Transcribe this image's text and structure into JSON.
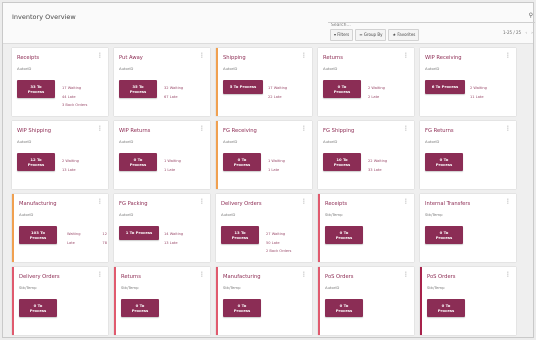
{
  "header": {
    "title": "Inventory Overview",
    "search_placeholder": "Search...",
    "filters": "▾ Filters",
    "group_by": "≡ Group By",
    "favorites": "★ Favorites",
    "pager": "1-25 / 25"
  },
  "cards": [
    {
      "title": "Receipts",
      "sub": "AutoriD",
      "btn": "33 To\nProcess",
      "stats": [
        "17 Waiting",
        "44 Late",
        "3 Back Orders"
      ],
      "bar": ""
    },
    {
      "title": "Put Away",
      "sub": "AutoriD",
      "btn": "35 To\nProcess",
      "stats": [
        "32 Waiting",
        "67 Late"
      ],
      "bar": ""
    },
    {
      "title": "Shipping",
      "sub": "AutoriD",
      "btn": "5 To Process",
      "stats": [
        "17 Waiting",
        "22 Late"
      ],
      "bar": "orange",
      "wide": true
    },
    {
      "title": "Returns",
      "sub": "AutoriD",
      "btn": "0 To\nProcess",
      "stats": [
        "2 Waiting",
        "2 Late"
      ],
      "bar": ""
    },
    {
      "title": "WIP Receiving",
      "sub": "AutoriD",
      "btn": "6 To Process",
      "stats": [
        "2 Waiting",
        "11 Late"
      ],
      "bar": "",
      "wide": true
    },
    {
      "title": "WIP Shipping",
      "sub": "AutoriD",
      "btn": "12 To\nProcess",
      "stats": [
        "2 Waiting",
        "13 Late"
      ],
      "bar": ""
    },
    {
      "title": "WIP Returns",
      "sub": "AutoriD",
      "btn": "0 To\nProcess",
      "stats": [
        "1 Waiting",
        "1 Late"
      ],
      "bar": ""
    },
    {
      "title": "FG Receiving",
      "sub": "AutoriD",
      "btn": "0 To\nProcess",
      "stats": [
        "1 Waiting",
        "1 Late"
      ],
      "bar": "orange"
    },
    {
      "title": "FG Shipping",
      "sub": "AutoriD",
      "btn": "10 To\nProcess",
      "stats": [
        "22 Waiting",
        "33 Late"
      ],
      "bar": ""
    },
    {
      "title": "FG Returns",
      "sub": "AutoriD",
      "btn": "0 To\nProcess",
      "stats": [],
      "bar": ""
    },
    {
      "title": "Manufacturing",
      "sub": "AutoriD",
      "btn": "103 To\nProcess",
      "kv": [
        [
          "Waiting",
          "12"
        ],
        [
          "Late",
          "78"
        ]
      ],
      "bar": "orange"
    },
    {
      "title": "FG Packing",
      "sub": "AutoriD",
      "btn": "1 To Process",
      "stats": [
        "14 Waiting",
        "13 Late"
      ],
      "bar": "",
      "wide": true
    },
    {
      "title": "Delivery Orders",
      "sub": "AutoriD",
      "btn": "13 To\nProcess",
      "stats": [
        "27 Waiting",
        "50 Late",
        "2 Back Orders"
      ],
      "bar": ""
    },
    {
      "title": "Receipts",
      "sub": "Stk/Temp",
      "btn": "0 To\nProcess",
      "stats": [],
      "bar": "red"
    },
    {
      "title": "Internal Transfers",
      "sub": "Stk/Temp",
      "btn": "0 To\nProcess",
      "stats": [],
      "bar": ""
    },
    {
      "title": "Delivery Orders",
      "sub": "Stk/Temp",
      "btn": "0 To\nProcess",
      "stats": [],
      "bar": "red"
    },
    {
      "title": "Returns",
      "sub": "Stk/Temp",
      "btn": "0 To\nProcess",
      "stats": [],
      "bar": "red"
    },
    {
      "title": "Manufacturing",
      "sub": "Stk/Temp",
      "btn": "0 To\nProcess",
      "stats": [],
      "bar": "red"
    },
    {
      "title": "PoS Orders",
      "sub": "AutoriD",
      "btn": "0 To\nProcess",
      "stats": [],
      "bar": "red"
    },
    {
      "title": "PoS Orders",
      "sub": "Stk/Temp",
      "btn": "0 To\nProcess",
      "stats": [],
      "bar": "crimson"
    }
  ]
}
